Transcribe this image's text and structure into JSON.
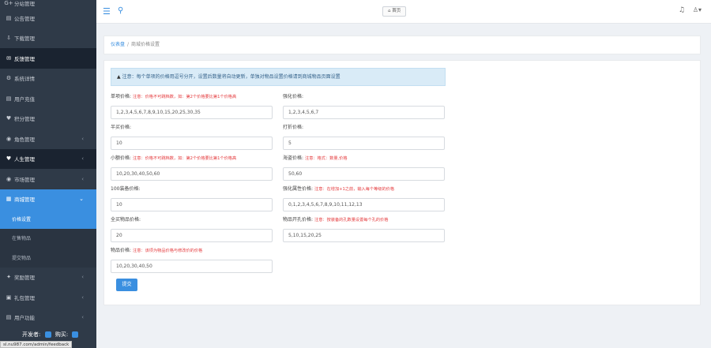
{
  "sidebar": {
    "items": [
      {
        "icon": "group-icon",
        "glyph": "G+",
        "label": "分站管理"
      },
      {
        "icon": "announce-icon",
        "glyph": "▤",
        "label": "公告管理"
      },
      {
        "icon": "download-icon",
        "glyph": "⇩",
        "label": "下载管理"
      },
      {
        "icon": "feedback-icon",
        "glyph": "✉",
        "label": "反馈管理"
      },
      {
        "icon": "settings-icon",
        "glyph": "⚙",
        "label": "系统详情"
      },
      {
        "icon": "users-icon",
        "glyph": "▤",
        "label": "用户充值"
      },
      {
        "icon": "points-icon",
        "glyph": "♥",
        "label": "积分管理"
      },
      {
        "icon": "role-icon",
        "glyph": "◉",
        "label": "角色管理"
      },
      {
        "icon": "business-icon",
        "glyph": "♥",
        "label": "人生管理"
      },
      {
        "icon": "eye-icon",
        "glyph": "◉",
        "label": "市场管理"
      },
      {
        "icon": "cart-icon",
        "glyph": "▦",
        "label": "商城管理"
      }
    ],
    "sub_items": [
      "价格设置",
      "在售物品",
      "提交物品"
    ],
    "items_after": [
      {
        "icon": "trophy-icon",
        "glyph": "🏆",
        "label": "奖励管理"
      },
      {
        "icon": "gift-icon",
        "glyph": "▣",
        "label": "礼包管理"
      },
      {
        "icon": "func-icon",
        "glyph": "▤",
        "label": "用户功能"
      }
    ],
    "footer": {
      "label": "开发者:",
      "label2": "购买:"
    },
    "status_url": "sl.nu987.com/admin/feedback"
  },
  "topbar": {
    "home_label": "⌂ 首页"
  },
  "breadcrumb": {
    "home": "仪表盘",
    "current": "商城价格设置"
  },
  "alert": "注意：每个单项的价格用逗号分开，设置后数量将自动更新，单独对物品设置价格请到商城物品页面设置",
  "fields": {
    "unit_price": {
      "label": "单项价格:",
      "note": "注意：价格不可跳档数，如：第2个价格要比第1个价格高",
      "value": "1,2,3,4,5,6,7,8,9,10,15,20,25,30,35"
    },
    "increase_price": {
      "label": "强化价格:",
      "value": "1,2,3,4,5,6,7"
    },
    "half_price": {
      "label": "半买价格:",
      "value": "10"
    },
    "discount_price": {
      "label": "打折价格:",
      "value": "5"
    },
    "bulk_price": {
      "label": "小额价格:",
      "note": "注意：价格不可跳档数，如：第2个价格要比第1个价格高",
      "value": "10,20,30,40,50,60"
    },
    "sea_price": {
      "label": "海盗价格:",
      "note": "注意：格式：数量,价格",
      "value": "50,60"
    },
    "equip_price": {
      "label": "100装备价格:",
      "value": "10"
    },
    "refine_price": {
      "label": "强化属性价格:",
      "note": "注意：在增加+1之前，输入每个等级的价格",
      "value": "0,1,2,3,4,5,6,7,8,9,10,11,12,13"
    },
    "full_price": {
      "label": "全买物品价格:",
      "value": "20"
    },
    "slot_price": {
      "label": "物品开孔价格:",
      "note": "注意：按装备的孔数量设置每个孔的价格",
      "value": "5,10,15,20,25"
    },
    "item_price": {
      "label": "物品价格:",
      "note": "注意：该项为物品价格与修改价的价格",
      "value": "10,20,30,40,50"
    }
  },
  "submit_label": "提交"
}
